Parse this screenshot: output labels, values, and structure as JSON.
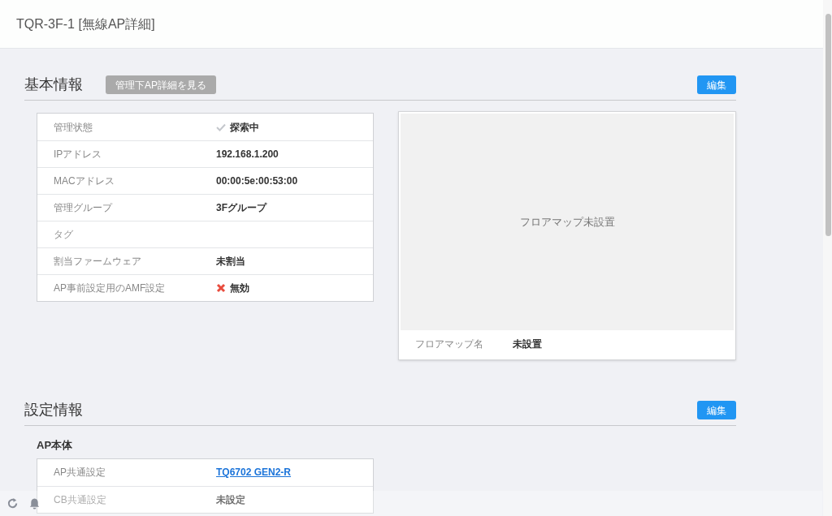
{
  "header": {
    "title": "TQR-3F-1 [無線AP詳細]"
  },
  "basic_info": {
    "heading": "基本情報",
    "sub_button": "管理下AP詳細を見る",
    "edit_button": "編集",
    "rows": [
      {
        "label": "管理状態",
        "value": "探索中",
        "kind": "check"
      },
      {
        "label": "IPアドレス",
        "value": "192.168.1.200",
        "kind": "text"
      },
      {
        "label": "MACアドレス",
        "value": "00:00:5e:00:53:00",
        "kind": "text"
      },
      {
        "label": "管理グループ",
        "value": "3Fグループ",
        "kind": "text"
      },
      {
        "label": "タグ",
        "kind": "empty"
      },
      {
        "label": "割当ファームウェア",
        "value": "未割当",
        "kind": "text"
      },
      {
        "label": "AP事前設定用のAMF設定",
        "value": "無効",
        "kind": "cross"
      }
    ],
    "floor_map": {
      "message": "フロアマップ未設置",
      "name_label": "フロアマップ名",
      "name_value": "未設置"
    }
  },
  "settings_info": {
    "heading": "設定情報",
    "edit_button": "編集",
    "group_title": "AP本体",
    "rows": [
      {
        "label": "AP共通設定",
        "value": "TQ6702 GEN2-R",
        "kind": "link"
      },
      {
        "label": "CB共通設定",
        "value": "未設定",
        "kind": "text"
      }
    ]
  }
}
